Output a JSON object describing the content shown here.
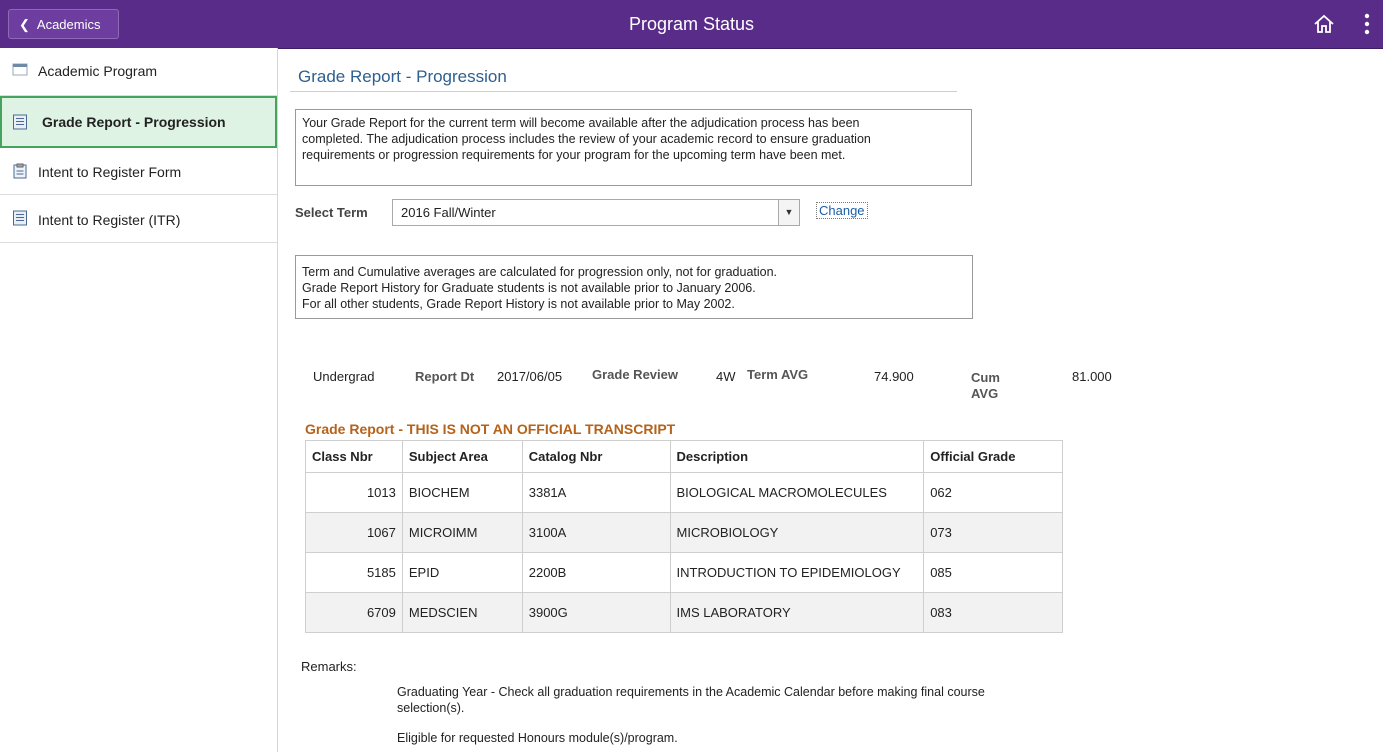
{
  "header": {
    "back_label": "Academics",
    "title": "Program Status"
  },
  "sidebar": {
    "items": [
      {
        "label": "Academic Program",
        "icon": "program-icon"
      },
      {
        "label": "Grade Report - Progression",
        "icon": "document-icon",
        "active": true
      },
      {
        "label": "Intent to Register Form",
        "icon": "clipboard-icon"
      },
      {
        "label": "Intent to Register (ITR)",
        "icon": "document-icon"
      }
    ]
  },
  "main": {
    "title": "Grade Report - Progression",
    "notice_lines": [
      "Your Grade Report for the current term will become available after the adjudication process has been",
      "completed. The adjudication process includes the review of your academic record to ensure graduation",
      "requirements or progression requirements for your program for the upcoming term have been met."
    ],
    "term_label": "Select Term",
    "term_value": "2016 Fall/Winter",
    "change_label": "Change",
    "note_lines": [
      "Term and Cumulative averages are calculated for progression only, not for graduation.",
      "Grade Report History for Graduate students is not available prior to January 2006.",
      "For all other students, Grade Report History is not available prior to May 2002."
    ],
    "summary": {
      "career": "Undergrad",
      "report_dt_label": "Report Dt",
      "report_dt": "2017/06/05",
      "grade_review_label": "Grade Review",
      "grade_review": "4W",
      "term_avg_label": "Term AVG",
      "term_avg": "74.900",
      "cum_avg_label_1": "Cum",
      "cum_avg_label_2": "AVG",
      "cum_avg": "81.000"
    },
    "report_heading": "Grade Report - THIS IS NOT AN OFFICIAL TRANSCRIPT",
    "table": {
      "headers": [
        "Class Nbr",
        "Subject Area",
        "Catalog Nbr",
        "Description",
        "Official Grade"
      ],
      "rows": [
        [
          "1013",
          "BIOCHEM",
          "3381A",
          "BIOLOGICAL MACROMOLECULES",
          "062"
        ],
        [
          "1067",
          "MICROIMM",
          "3100A",
          "MICROBIOLOGY",
          "073"
        ],
        [
          "5185",
          "EPID",
          "2200B",
          "INTRODUCTION TO EPIDEMIOLOGY",
          "085"
        ],
        [
          "6709",
          "MEDSCIEN",
          "3900G",
          "IMS LABORATORY",
          "083"
        ]
      ]
    },
    "remarks_label": "Remarks:",
    "remarks": [
      "Graduating Year - Check all graduation requirements in the Academic Calendar before making final course selection(s).",
      "Eligible for requested Honours module(s)/program."
    ]
  },
  "colors": {
    "header_bg": "#5a2c8a",
    "active_bg": "#dff3e4",
    "active_border": "#46a35e",
    "title_color": "#2d5f8f",
    "heading_color": "#b5621a"
  }
}
